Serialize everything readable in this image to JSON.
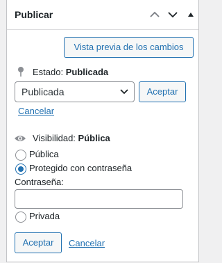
{
  "panel": {
    "title": "Publicar",
    "controls": {
      "up_icon": "chevron-up-icon",
      "down_icon": "chevron-down-icon",
      "toggle_icon": "triangle-up-icon"
    }
  },
  "preview_button": "Vista previa de los cambios",
  "status": {
    "label": "Estado:",
    "value": "Publicada",
    "icon": "pin-icon",
    "select_value": "Publicada",
    "accept": "Aceptar",
    "cancel": "Cancelar"
  },
  "visibility": {
    "label": "Visibilidad:",
    "value": "Pública",
    "icon": "eye-icon",
    "options": [
      "Pública",
      "Protegido con contraseña",
      "Privada"
    ],
    "selected": "Protegido con contraseña",
    "password_label": "Contraseña:",
    "password_value": "",
    "accept": "Aceptar",
    "cancel": "Cancelar"
  },
  "colors": {
    "accent": "#2271b1",
    "border": "#c3c4c7",
    "text": "#1d2327",
    "background": "#f0f0f1"
  }
}
